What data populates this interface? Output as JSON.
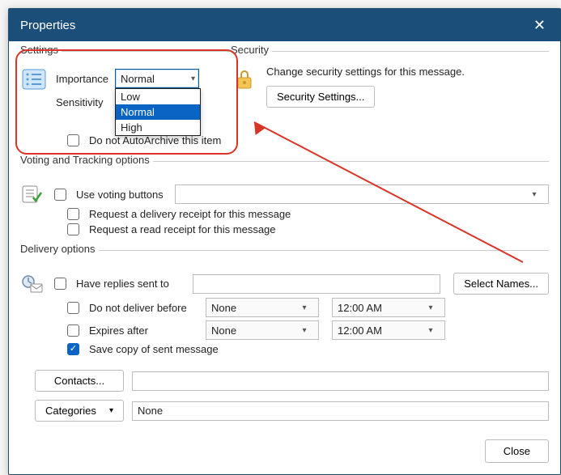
{
  "window": {
    "title": "Properties"
  },
  "settings": {
    "legend": "Settings",
    "importance_label": "Importance",
    "sensitivity_label": "Sensitivity",
    "importance_value": "Normal",
    "importance_options": {
      "low": "Low",
      "normal": "Normal",
      "high": "High"
    },
    "auto_archive_label": "Do not AutoArchive this item"
  },
  "security": {
    "legend": "Security",
    "text": "Change security settings for this message.",
    "button": "Security Settings..."
  },
  "voting": {
    "legend": "Voting and Tracking options",
    "use_voting_label": "Use voting buttons",
    "delivery_receipt_label": "Request a delivery receipt for this message",
    "read_receipt_label": "Request a read receipt for this message"
  },
  "delivery": {
    "legend": "Delivery options",
    "have_replies_label": "Have replies sent to",
    "select_names_button": "Select Names...",
    "not_before_label": "Do not deliver before",
    "not_before_date": "None",
    "not_before_time": "12:00 AM",
    "expires_label": "Expires after",
    "expires_date": "None",
    "expires_time": "12:00 AM",
    "save_copy_label": "Save copy of sent message"
  },
  "buttons": {
    "contacts": "Contacts...",
    "categories": "Categories",
    "categories_value": "None",
    "close": "Close"
  }
}
